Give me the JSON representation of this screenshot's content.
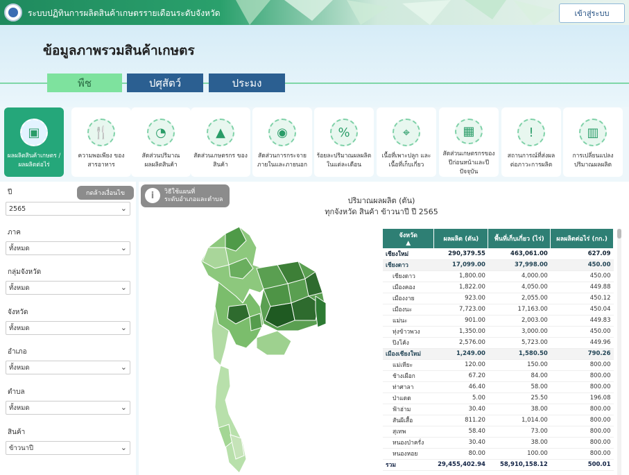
{
  "topbar": {
    "app_title": "ระบบปฏิทินการผลิตสินค้าเกษตรรายเดือนระดับจังหวัด",
    "login_label": "เข้าสู่ระบบ"
  },
  "page": {
    "title": "ข้อมูลภาพรวมสินค้าเกษตร"
  },
  "tabs": [
    {
      "label": "พืช",
      "active": true
    },
    {
      "label": "ปศุสัตว์",
      "active": false
    },
    {
      "label": "ประมง",
      "active": false
    }
  ],
  "categories": [
    {
      "label": "ผลผลิตสินค้าเกษตร / ผลผลิตต่อไร่",
      "icon": "box-icon",
      "active": true
    },
    {
      "label": "ความพอเพียง ของสารอาหาร",
      "icon": "utensils-icon"
    },
    {
      "label": "สัดส่วนปริมาณ ผลผลิตสินค้า",
      "icon": "pie-chart-icon"
    },
    {
      "label": "สัดส่วนเกษตรกร ของสินค้า",
      "icon": "farmer-icon"
    },
    {
      "label": "สัดส่วนการกระจาย ภายในและภายนอก",
      "icon": "globe-pin-icon"
    },
    {
      "label": "ร้อยละปริมาณผลผลิต ในแต่ละเดือน",
      "icon": "percent-icon"
    },
    {
      "label": "เนื้อที่เพาะปลูก และเนื้อที่เก็บเกี่ยว",
      "icon": "map-pin-icon"
    },
    {
      "label": "สัดส่วนเกษตรกรของ ปีก่อนหน้าและปีปัจจุบัน",
      "icon": "calendar-users-icon"
    },
    {
      "label": "สถานการณ์ที่ส่งผล ต่อภาวะการผลิต",
      "icon": "chat-alert-icon"
    },
    {
      "label": "การเปลี่ยนแปลง ปริมาณผลผลิต",
      "icon": "bar-chart-icon"
    }
  ],
  "filters": {
    "clear_label": "กดล้างเงื่อนไข",
    "fields": [
      {
        "label": "ปี",
        "value": "2565"
      },
      {
        "label": "ภาค",
        "value": "ทั้งหมด"
      },
      {
        "label": "กลุ่มจังหวัด",
        "value": "ทั้งหมด"
      },
      {
        "label": "จังหวัด",
        "value": "ทั้งหมด"
      },
      {
        "label": "อำเภอ",
        "value": "ทั้งหมด"
      },
      {
        "label": "ตำบล",
        "value": "ทั้งหมด"
      },
      {
        "label": "สินค้า",
        "value": "ข้าวนาปี"
      }
    ]
  },
  "main": {
    "guide_label_1": "วิธีใช้แผนที่",
    "guide_label_2": "ระดับอำเภอและตำบล",
    "title_line1": "ปริมาณผลผลิต (ตัน)",
    "title_line2": "ทุกจังหวัด สินค้า ข้าวนาปี ปี 2565"
  },
  "table": {
    "headers": [
      "จังหวัด",
      "ผลผลิต (ตัน)",
      "พื้นที่เก็บเกี่ยว (ไร่)",
      "ผลผลิตต่อไร่ (กก.)"
    ],
    "rows": [
      {
        "type": "prov",
        "name": "เชียงใหม่",
        "production": "290,379.55",
        "area": "463,061.00",
        "yield": "627.09"
      },
      {
        "type": "dist",
        "name": "เชียงดาว",
        "production": "17,099.00",
        "area": "37,998.00",
        "yield": "450.00"
      },
      {
        "type": "sub",
        "name": "เชียงดาว",
        "production": "1,800.00",
        "area": "4,000.00",
        "yield": "450.00"
      },
      {
        "type": "sub",
        "name": "เมืองคอง",
        "production": "1,822.00",
        "area": "4,050.00",
        "yield": "449.88"
      },
      {
        "type": "sub",
        "name": "เมืองงาย",
        "production": "923.00",
        "area": "2,055.00",
        "yield": "450.12"
      },
      {
        "type": "sub",
        "name": "เมืองนะ",
        "production": "7,723.00",
        "area": "17,163.00",
        "yield": "450.04"
      },
      {
        "type": "sub",
        "name": "แม่นะ",
        "production": "901.00",
        "area": "2,003.00",
        "yield": "449.83"
      },
      {
        "type": "sub",
        "name": "ทุ่งข้าวพวง",
        "production": "1,350.00",
        "area": "3,000.00",
        "yield": "450.00"
      },
      {
        "type": "sub",
        "name": "ปิงโค้ง",
        "production": "2,576.00",
        "area": "5,723.00",
        "yield": "449.96"
      },
      {
        "type": "dist",
        "name": "เมืองเชียงใหม่",
        "production": "1,249.00",
        "area": "1,580.50",
        "yield": "790.26"
      },
      {
        "type": "sub",
        "name": "แม่เหียะ",
        "production": "120.00",
        "area": "150.00",
        "yield": "800.00"
      },
      {
        "type": "sub",
        "name": "ช้างเผือก",
        "production": "67.20",
        "area": "84.00",
        "yield": "800.00"
      },
      {
        "type": "sub",
        "name": "ท่าศาลา",
        "production": "46.40",
        "area": "58.00",
        "yield": "800.00"
      },
      {
        "type": "sub",
        "name": "ป่าแดด",
        "production": "5.00",
        "area": "25.50",
        "yield": "196.08"
      },
      {
        "type": "sub",
        "name": "ฟ้าฮ่าม",
        "production": "30.40",
        "area": "38.00",
        "yield": "800.00"
      },
      {
        "type": "sub",
        "name": "สันผีเสื้อ",
        "production": "811.20",
        "area": "1,014.00",
        "yield": "800.00"
      },
      {
        "type": "sub",
        "name": "สุเทพ",
        "production": "58.40",
        "area": "73.00",
        "yield": "800.00"
      },
      {
        "type": "sub",
        "name": "หนองป่าครั่ง",
        "production": "30.40",
        "area": "38.00",
        "yield": "800.00"
      },
      {
        "type": "sub",
        "name": "หนองหอย",
        "production": "80.00",
        "area": "100.00",
        "yield": "800.00"
      },
      {
        "type": "total",
        "name": "รวม",
        "production": "29,455,402.94",
        "area": "58,910,158.12",
        "yield": "500.01"
      }
    ]
  },
  "colors": {
    "accent_green": "#25a77a",
    "tab_blue": "#2b5f91",
    "table_header": "#2e7f74",
    "map_dark": "#2e6b2e",
    "map_light": "#c5e3b8"
  }
}
